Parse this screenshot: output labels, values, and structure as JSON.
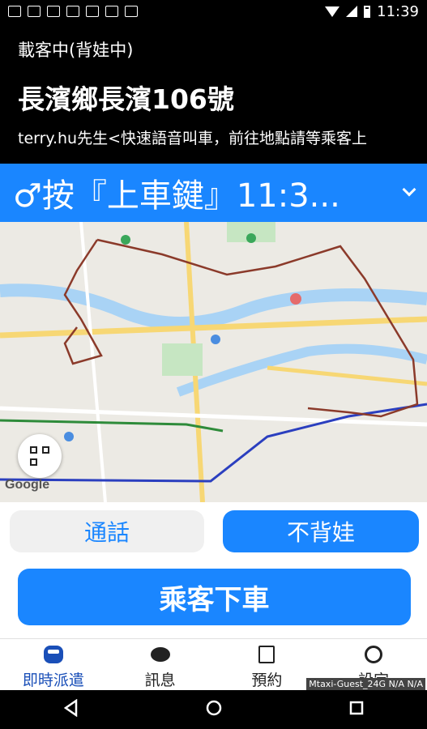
{
  "status_bar": {
    "time": "11:39"
  },
  "header": {
    "status": "載客中(背娃中)",
    "address": "長濱鄉長濱106號",
    "passenger_info": "terry.hu先生<快速語音叫車，前往地點請等乘客上"
  },
  "banner": {
    "text": "♂按『上車鍵』11:3..."
  },
  "map": {
    "attribution": "Google"
  },
  "actions": {
    "call_label": "通話",
    "no_back_label": "不背娃",
    "alight_label": "乘客下車"
  },
  "tabs": [
    {
      "label": "即時派遣",
      "icon": "car-icon",
      "active": true
    },
    {
      "label": "訊息",
      "icon": "chat-bubble-icon"
    },
    {
      "label": "預約",
      "icon": "note-edit-icon"
    },
    {
      "label": "設定",
      "icon": "gear-icon"
    }
  ],
  "wifi_note": "Mtaxi-Guest_24G N/A N/A",
  "colors": {
    "accent": "#1a86ff",
    "tab_active": "#1a4fb8",
    "route": "#8b3a2a"
  }
}
